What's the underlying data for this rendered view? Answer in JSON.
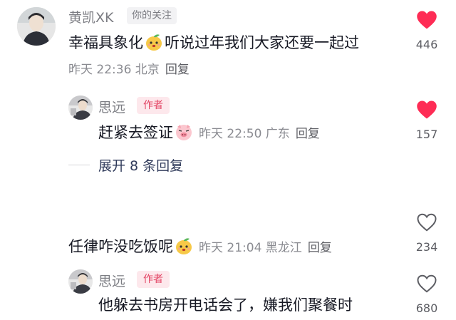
{
  "comments": [
    {
      "username": "黄凯XK",
      "badge": "你的关注",
      "text_a": "幸福具象化",
      "emoji": "mango-emoji",
      "text_b": "听说过年我们大家还要一起过",
      "meta": "昨天 22:36 北京",
      "reply_label": "回复",
      "likes": "446",
      "liked": true,
      "replies": [
        {
          "username": "思远",
          "badge": "作者",
          "text": "赶紧去签证",
          "emoji": "pig-emoji",
          "meta": "昨天 22:50 广东",
          "reply_label": "回复",
          "likes": "157",
          "liked": true
        }
      ],
      "expand_label": "展开 8 条回复"
    },
    {
      "text": "任律咋没吃饭呢",
      "emoji": "mango-emoji",
      "meta": "昨天 21:04 黑龙江",
      "reply_label": "回复",
      "likes": "234",
      "liked": false,
      "replies": [
        {
          "username": "思远",
          "badge": "作者",
          "text": "他躲去书房开电话会了，嫌我们聚餐时",
          "likes": "680",
          "liked": false
        }
      ]
    }
  ],
  "colors": {
    "like_active": "#fe2c55",
    "like_inactive": "#5c5d63",
    "author_badge_text": "#e34565",
    "author_badge_bg": "#fde8ec"
  }
}
